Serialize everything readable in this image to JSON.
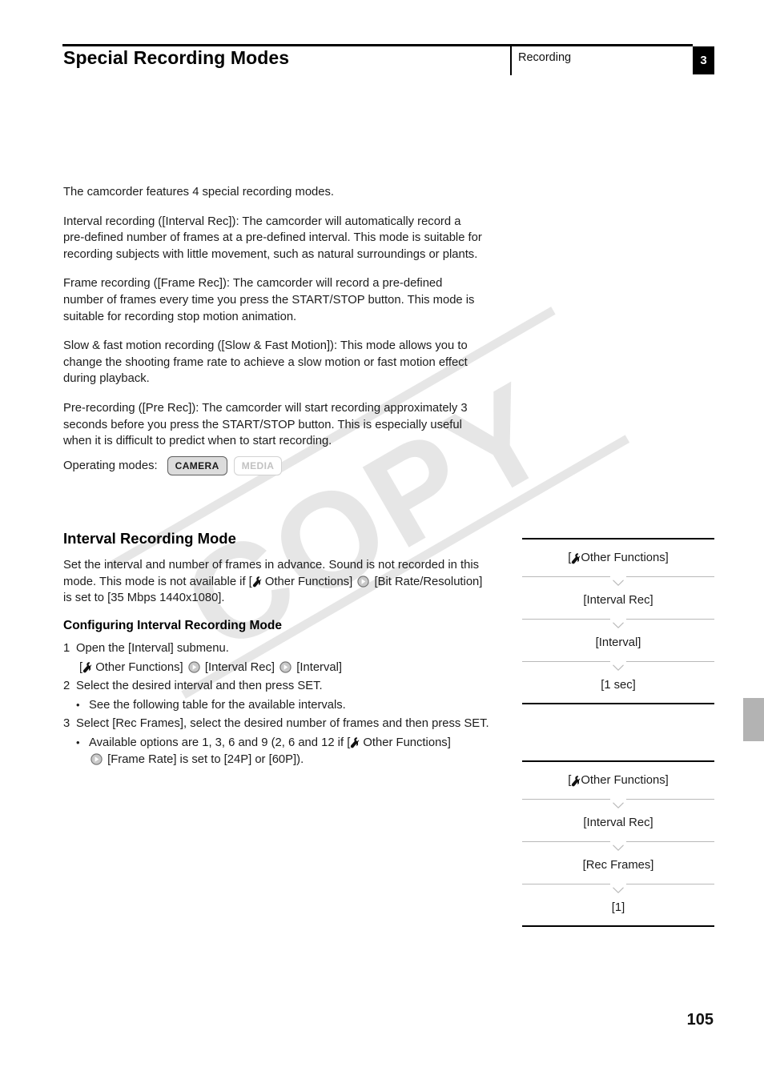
{
  "header": {
    "title": "Special Recording Modes",
    "section": "Recording",
    "chapter": "3"
  },
  "body": {
    "paragraphs": [
      "The camcorder features 4 special recording modes.",
      "Interval recording ([Interval Rec]): The camcorder will automatically record a pre-defined number of frames at a pre-defined interval. This mode is suitable for recording subjects with little movement, such as natural surroundings or plants.",
      "Frame recording ([Frame Rec]): The camcorder will record a pre-defined number of frames every time you press the START/STOP button. This mode is suitable for recording stop motion animation.",
      "Slow & fast motion recording ([Slow & Fast Motion]): This mode allows you to change the shooting frame rate to achieve a slow motion or fast motion effect during playback.",
      "Pre-recording ([Pre Rec]): The camcorder will start recording approximately 3 seconds before you press the START/STOP button. This is especially useful when it is difficult to predict when to start recording."
    ]
  },
  "operating_modes": {
    "label": "Operating modes:",
    "chips": [
      {
        "label": "CAMERA",
        "active": true
      },
      {
        "label": "MEDIA",
        "active": false
      }
    ]
  },
  "section": {
    "heading": "Interval Recording Mode",
    "intro_part1": "Set the interval and number of frames in advance. Sound is not recorded in this mode. This mode is not available if [",
    "intro_other_functions": " Other Functions] ",
    "intro_part2": " [Bit Rate/Resolution] is set to [35 Mbps 1440x1080].",
    "sub_heading": "Configuring Interval Recording Mode"
  },
  "steps": {
    "step1": {
      "num": "1",
      "text": "Open the [Interval] submenu.",
      "path_open": "[",
      "path_other_functions": " Other Functions] ",
      "path_interval_rec": " [Interval Rec] ",
      "path_interval": " [Interval]"
    },
    "step2": {
      "num": "2",
      "text": "Select the desired interval and then press SET.",
      "bullet": "See the following table for the available intervals."
    },
    "step3": {
      "num": "3",
      "text": "Select [Rec Frames], select the desired number of frames and then press SET.",
      "bullet_part1": "Available options are 1, 3, 6 and 9 (2, 6 and 12 if [",
      "bullet_other_functions": " Other Functions]",
      "bullet_part2": " [Frame Rate] is set to [24P] or [60P])."
    }
  },
  "menu_flows": [
    {
      "rows": [
        {
          "prefix": "[",
          "icon": "wrench",
          "label": " Other Functions]"
        },
        {
          "label": "[Interval Rec]"
        },
        {
          "label": "[Interval]"
        },
        {
          "label": "[1 sec]"
        }
      ]
    },
    {
      "rows": [
        {
          "prefix": "[",
          "icon": "wrench",
          "label": " Other Functions]"
        },
        {
          "label": "[Interval Rec]"
        },
        {
          "label": "[Rec Frames]"
        },
        {
          "label": "[1]"
        }
      ]
    }
  ],
  "menu_flow_1": {
    "row1": "  Other Functions]",
    "row2": "[Interval Rec]",
    "row3": "[Interval]",
    "row4": "[1 sec]"
  },
  "menu_flow_2": {
    "row1": "  Other Functions]",
    "row2": "[Interval Rec]",
    "row3": "[Rec Frames]",
    "row4": "[1]"
  },
  "watermark": {
    "text": "COPY"
  },
  "footer": {
    "page_number": "105"
  },
  "colors": {
    "text": "#1c1c1c",
    "rule": "#000000",
    "badge_bg": "#000000",
    "side_tab": "#b3b3b3",
    "watermark": "#e6e6e6",
    "chip_active_bg": "#dcdcdc",
    "chip_inactive_text": "#c2c2c2"
  }
}
